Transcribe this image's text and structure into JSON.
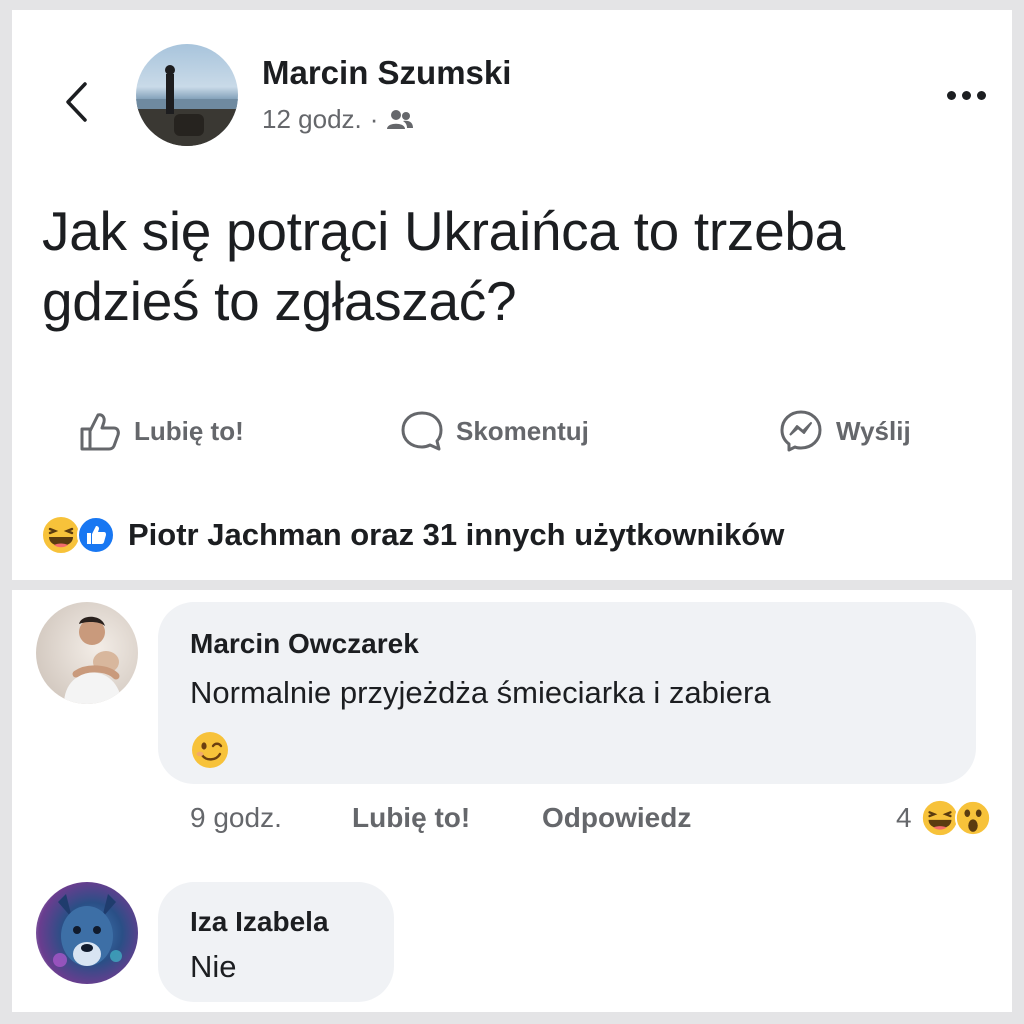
{
  "post": {
    "author": "Marcin Szumski",
    "time": "12 godz.",
    "separator": "·",
    "audience_icon": "friends-icon",
    "text": "Jak się potrąci Ukraińca to trzeba gdzieś to zgłaszać?",
    "actions": {
      "like": "Lubię to!",
      "comment": "Skomentuj",
      "send": "Wyślij"
    },
    "reactions": {
      "icons": [
        "haha-icon",
        "like-icon"
      ],
      "summary": "Piotr Jachman oraz 31 innych użytkowników"
    }
  },
  "comments": [
    {
      "author": "Marcin Owczarek",
      "text": "Normalnie przyjeżdża śmieciarka i zabiera",
      "emoji": "wink-emoji",
      "time": "9 godz.",
      "like": "Lubię to!",
      "reply": "Odpowiedz",
      "reaction_count": "4",
      "reaction_icons": [
        "haha-icon",
        "wow-icon"
      ]
    },
    {
      "author": "Iza Izabela",
      "text": "Nie"
    }
  ],
  "colors": {
    "text": "#1c1e21",
    "secondary": "#65676b",
    "bubble": "#f0f2f5",
    "like_blue": "#1877f2",
    "emoji_yellow": "#f7c23a"
  }
}
